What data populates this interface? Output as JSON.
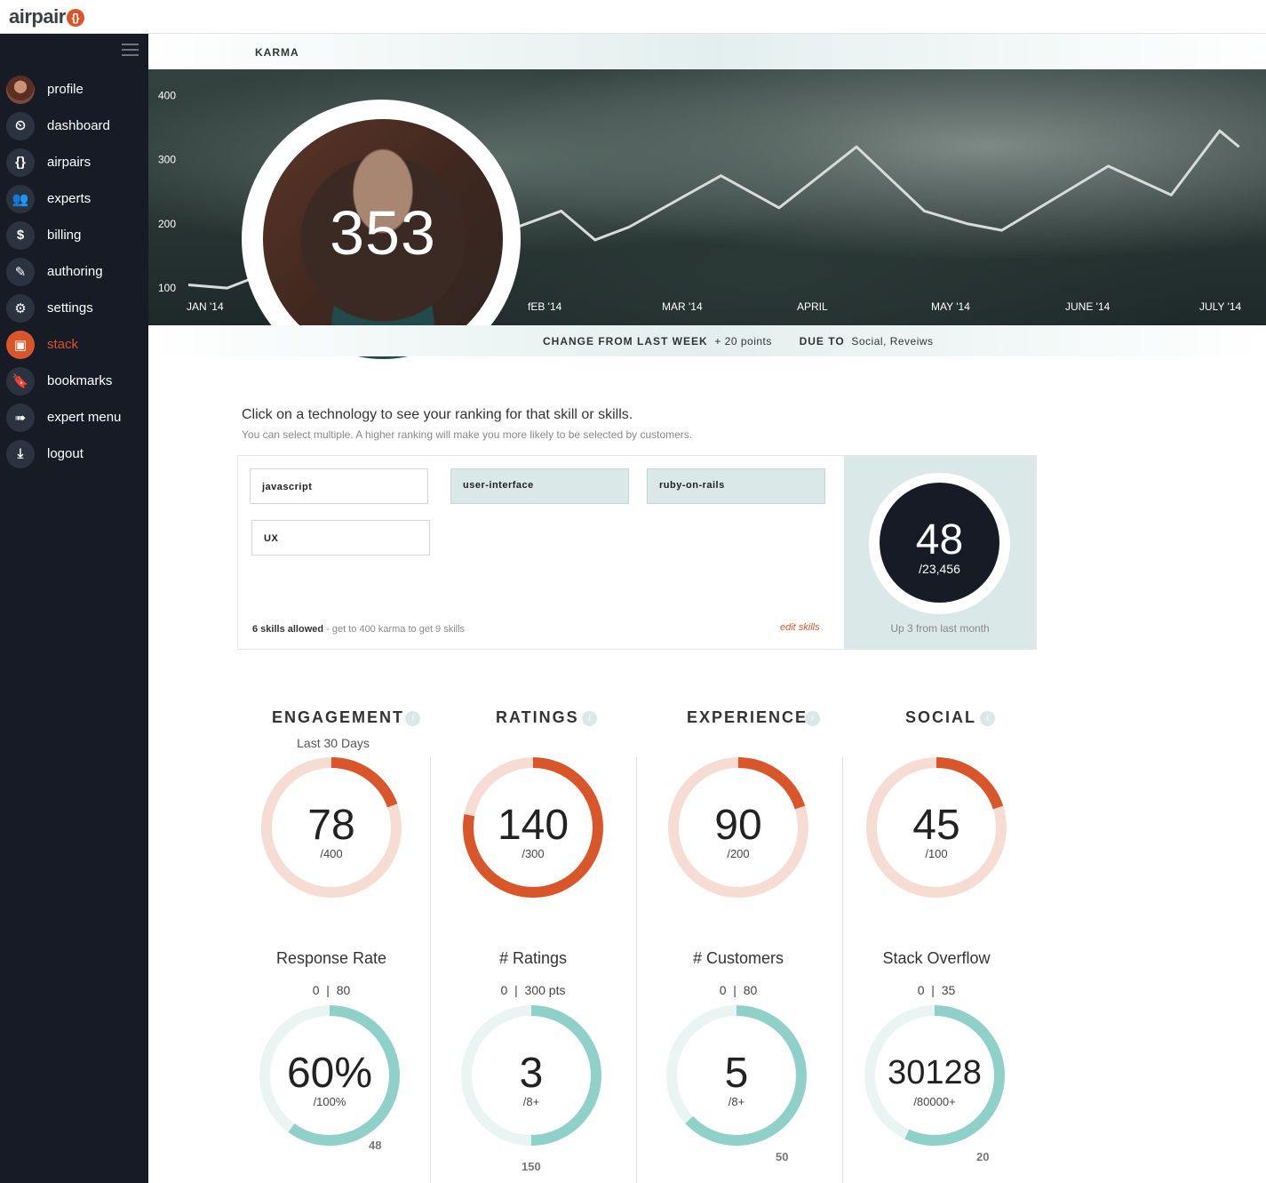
{
  "brand": {
    "name": "airpair",
    "brace": "{}"
  },
  "sidebar": {
    "items": [
      {
        "label": "profile"
      },
      {
        "label": "dashboard"
      },
      {
        "label": "airpairs"
      },
      {
        "label": "experts"
      },
      {
        "label": "billing"
      },
      {
        "label": "authoring"
      },
      {
        "label": "settings"
      },
      {
        "label": "stack"
      },
      {
        "label": "bookmarks"
      },
      {
        "label": "expert menu"
      },
      {
        "label": "logout"
      }
    ],
    "active": "stack"
  },
  "karma": {
    "title": "KARMA",
    "value": "353",
    "change_label": "CHANGE FROM LAST WEEK",
    "change_value": "+ 20 points",
    "due_label": "DUE TO",
    "due_value": "Social, Reveiws"
  },
  "chart_data": {
    "type": "line",
    "title": "KARMA",
    "xlabel": "",
    "ylabel": "",
    "yticks": [
      "400",
      "300",
      "200",
      "100"
    ],
    "ylim": [
      60,
      420
    ],
    "xticks": [
      "JAN '14",
      "fEB '14",
      "MAR '14",
      "APRIL",
      "MAY '14",
      "JUNE '14",
      "JULY '14"
    ],
    "x": [
      0,
      0.4,
      1,
      1.3,
      2.5,
      2.85,
      3.85,
      4.2,
      4.55,
      5.5,
      6.1,
      6.9,
      7.6,
      8.05,
      8.4,
      9.5,
      10.15,
      10.65,
      10.85
    ],
    "values": [
      105,
      100,
      135,
      125,
      140,
      165,
      220,
      175,
      195,
      275,
      225,
      320,
      220,
      200,
      190,
      290,
      245,
      345,
      320
    ],
    "grid": false,
    "legend": "none"
  },
  "skills": {
    "heading": "Click on a technology to see your ranking for that skill or skills.",
    "subheading": "You can select multiple. A higher ranking will make you more likely to be selected  by customers.",
    "tags": [
      {
        "label": "javascript",
        "selected": false
      },
      {
        "label": "user-interface",
        "selected": true
      },
      {
        "label": "ruby-on-rails",
        "selected": true
      },
      {
        "label": "UX",
        "selected": false
      }
    ],
    "allowed_bold": "6 skills allowed",
    "allowed_rest": " - get to 400 karma to get 9 skills",
    "edit": "edit skills",
    "rank": {
      "value": "48",
      "total": "/23,456",
      "note": "Up 3 from last month"
    }
  },
  "metrics": [
    {
      "title": "ENGAGEMENT",
      "info": "i",
      "subtitle": "Last 30 Days",
      "top": {
        "value": "78",
        "max": "/400",
        "fraction": 0.195
      },
      "bottom": {
        "title": "Response Rate",
        "range_min": "0",
        "range_max": "80",
        "value": "60%",
        "max": "/100%",
        "fraction": 0.6,
        "end": "48"
      }
    },
    {
      "title": "RATINGS",
      "info": "i",
      "top": {
        "value": "140",
        "max": "/300",
        "fraction": 0.78
      },
      "bottom": {
        "title": "# Ratings",
        "range_min": "0",
        "range_max": "300 pts",
        "value": "3",
        "max": "/8+",
        "fraction": 0.5,
        "end": "150"
      }
    },
    {
      "title": "EXPERIENCE",
      "info": "i",
      "top": {
        "value": "90",
        "max": "/200",
        "fraction": 0.2
      },
      "bottom": {
        "title": "# Customers",
        "range_min": "0",
        "range_max": "80",
        "value": "5",
        "max": "/8+",
        "fraction": 0.63,
        "end": "50"
      }
    },
    {
      "title": "SOCIAL",
      "info": "i",
      "top": {
        "value": "45",
        "max": "/100",
        "fraction": 0.2
      },
      "bottom": {
        "title": "Stack Overflow",
        "range_min": "0",
        "range_max": "35",
        "value": "30128",
        "max": "/80000+",
        "fraction": 0.57,
        "end": "20"
      }
    }
  ],
  "colors": {
    "sidebar": "#161b26",
    "accent": "#d9552a",
    "accent_light": "#f6dcd3",
    "teal": "#8fd1c9",
    "teal_light": "#eaf5f3",
    "selected_tag": "#dae9e7"
  },
  "icons": [
    "avatar",
    "dashboard-gauge-icon",
    "braces-icon",
    "users-icon",
    "dollar-icon",
    "pen-icon",
    "gear-icon",
    "box-icon",
    "bookmark-icon",
    "arrow-right-icon",
    "logout-icon"
  ]
}
